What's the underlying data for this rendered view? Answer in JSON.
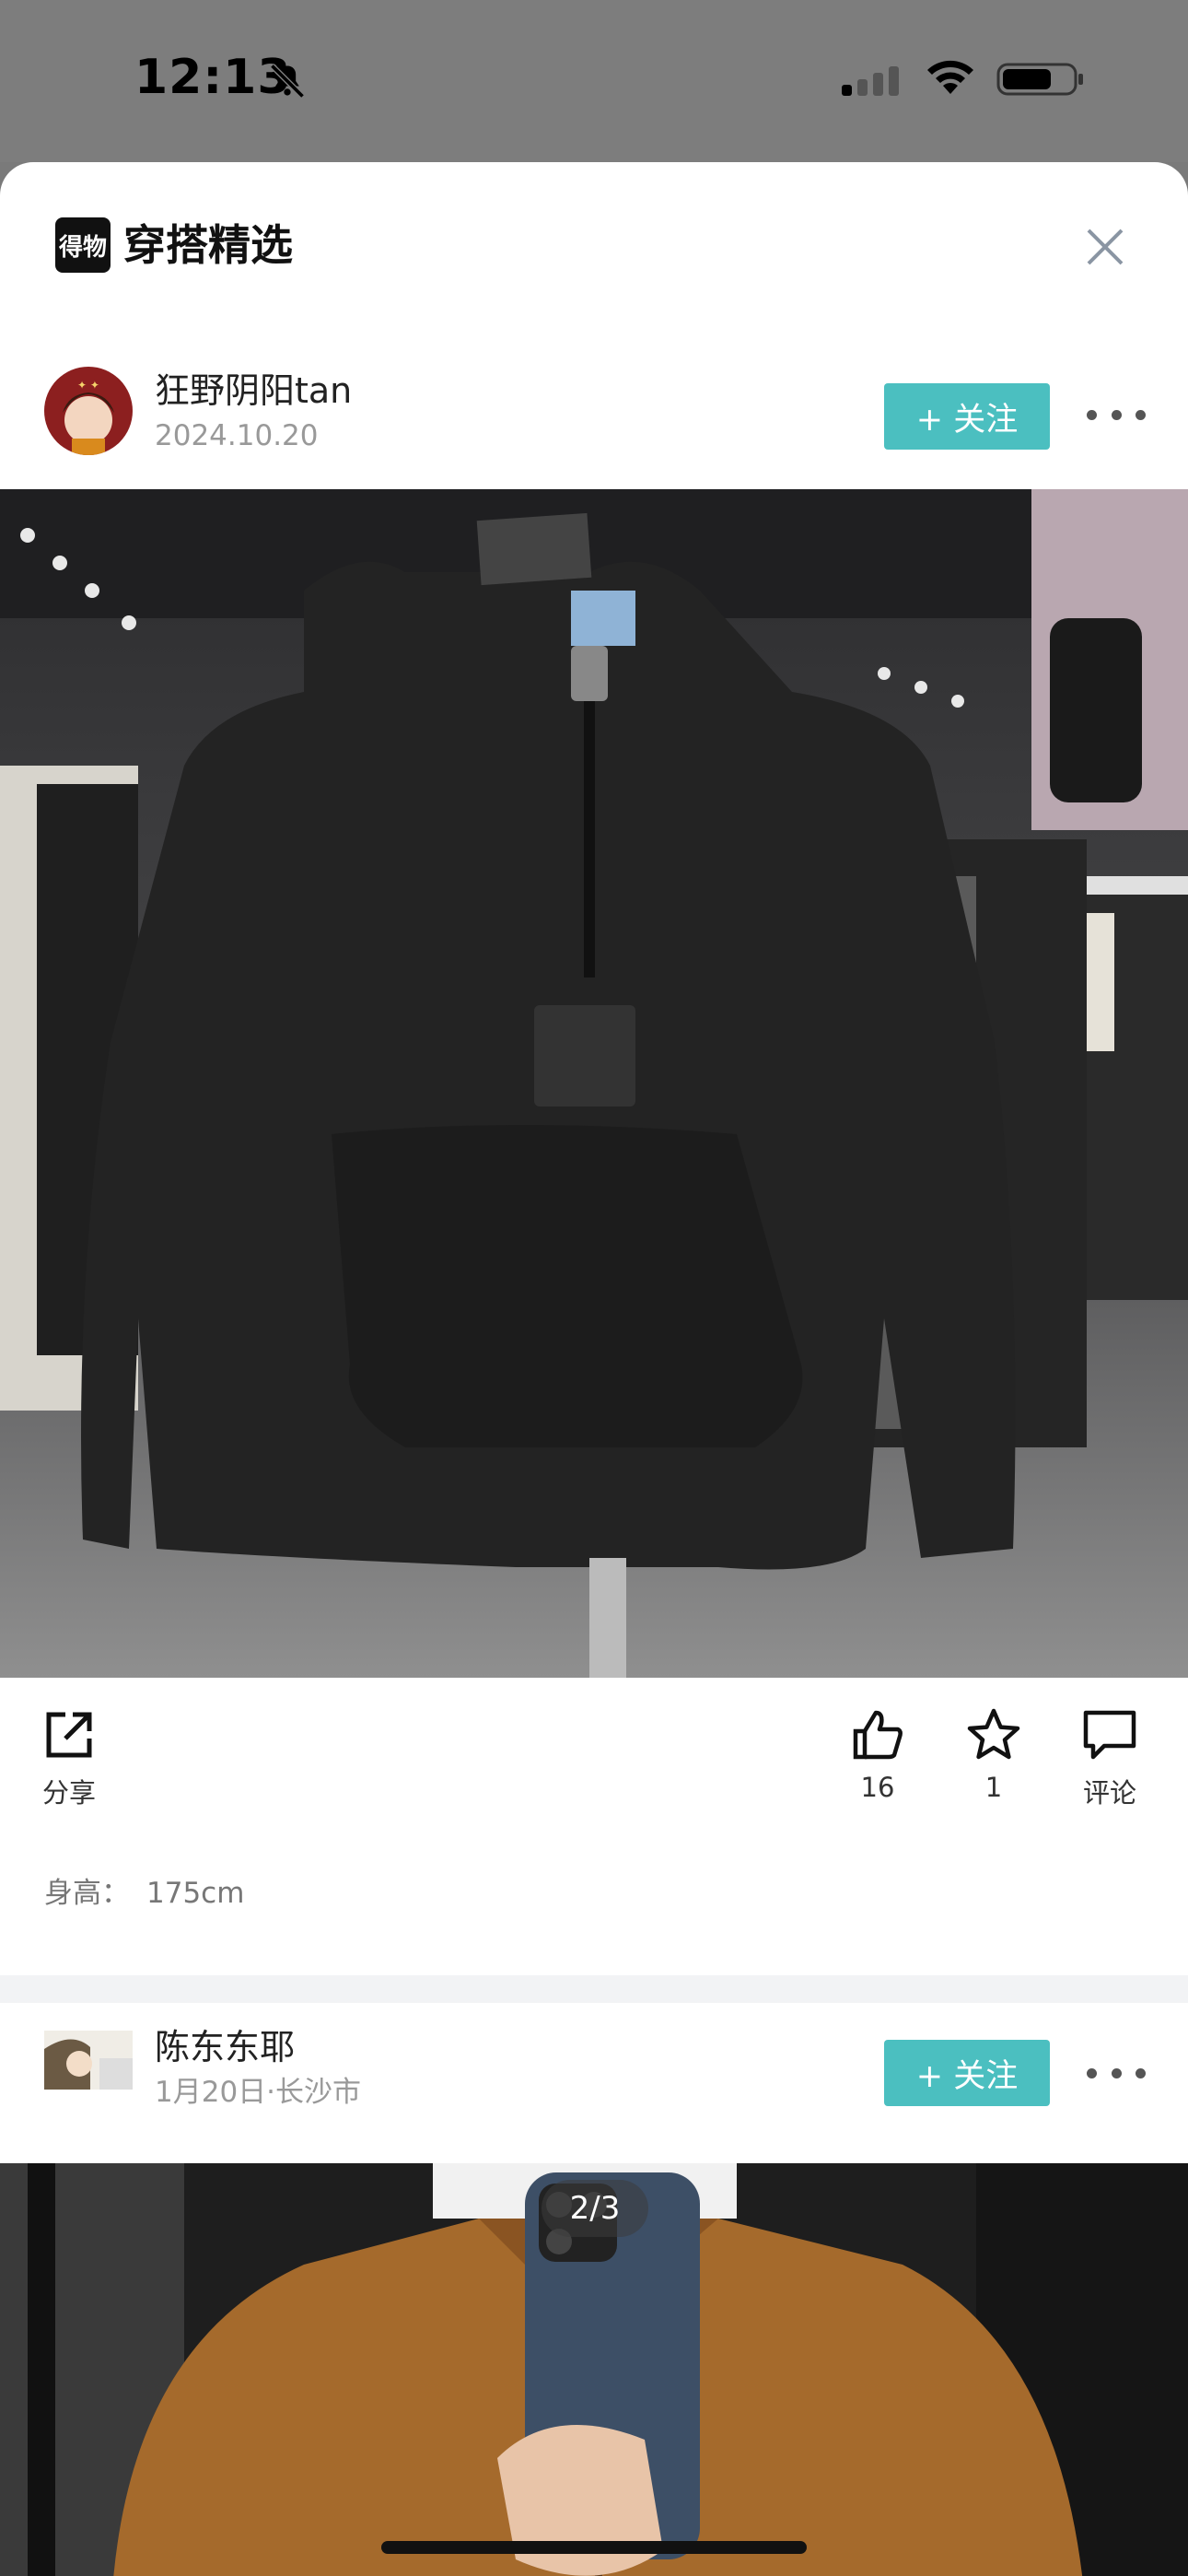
{
  "status_bar": {
    "time": "12:13"
  },
  "header": {
    "logo_text": "得物",
    "title": "穿搭精选"
  },
  "posts": [
    {
      "user": "狂野阴阳tan",
      "meta": "2024.10.20",
      "follow_label": "+ 关注",
      "actions": {
        "share_label": "分享",
        "like_count": "16",
        "fav_count": "1",
        "comment_label": "评论"
      },
      "height_label": "身高：",
      "height_value": "175cm"
    },
    {
      "user": "陈东东耶",
      "meta": "1月20日·长沙市",
      "follow_label": "+ 关注",
      "pager": "2/3"
    }
  ],
  "colors": {
    "accent": "#4bbfc0",
    "divider": "#f2f3f5"
  }
}
